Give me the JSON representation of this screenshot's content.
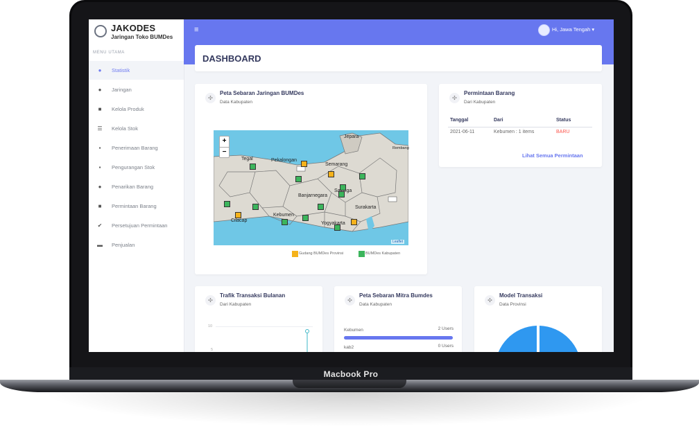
{
  "device": {
    "label": "Macbook Pro"
  },
  "brand": {
    "name": "JAKODES",
    "subtitle": "Jaringan Toko BUMDes"
  },
  "menu": {
    "heading": "MENU UTAMA",
    "items": [
      {
        "label": "Statistik",
        "icon": "dashboard-icon",
        "active": true
      },
      {
        "label": "Jaringan",
        "icon": "network-icon"
      },
      {
        "label": "Kelola Produk",
        "icon": "box-icon"
      },
      {
        "label": "Kelola Stok",
        "icon": "list-icon"
      },
      {
        "label": "Penerimaan Barang",
        "icon": "boxes-icon"
      },
      {
        "label": "Pengurangan Stok",
        "icon": "boxes-icon"
      },
      {
        "label": "Penarikan Barang",
        "icon": "truck-icon"
      },
      {
        "label": "Permintaan Barang",
        "icon": "clipboard-icon"
      },
      {
        "label": "Persetujuan Permintaan",
        "icon": "check-icon"
      },
      {
        "label": "Penjualan",
        "icon": "money-icon"
      }
    ]
  },
  "topbar": {
    "user_greeting": "Hi, Jawa Tengah"
  },
  "page": {
    "title": "DASHBOARD"
  },
  "map_card": {
    "title": "Peta Sebaran Jaringan BUMDes",
    "subtitle": "Data Kabupaten",
    "labels": [
      "Jepara",
      "Rembang",
      "Tegal",
      "Pekalongan",
      "Semarang",
      "Salatiga",
      "Banjarnegara",
      "Surakarta",
      "Kebumen",
      "Cilacap",
      "Yogyakarta"
    ],
    "legend": [
      {
        "label": "Gudang BUMDes Provinsi",
        "color": "#f5b21b"
      },
      {
        "label": "BUMDes Kabupaten",
        "color": "#3cb55c"
      }
    ],
    "attribution": "Leaflet"
  },
  "request_card": {
    "title": "Permintaan Barang",
    "subtitle": "Dari Kabupaten",
    "columns": [
      "Tanggal",
      "Dari",
      "Status"
    ],
    "rows": [
      {
        "date": "2021-06-11",
        "from": "Kebumen : 1 items",
        "status": "BARU"
      }
    ],
    "link": "Lihat Semua Permintaan"
  },
  "traffic_card": {
    "title": "Trafik Transaksi Bulanan",
    "subtitle": "Dari Kabupaten",
    "y_ticks": [
      "10",
      "5"
    ]
  },
  "partner_card": {
    "title": "Peta Sebaran Mitra Bumdes",
    "subtitle": "Data Kabupaten",
    "rows": [
      {
        "name": "Kebumen",
        "users": "2 Users",
        "fraction": 1.0
      },
      {
        "name": "kab2",
        "users": "0 Users",
        "fraction": 0.0
      }
    ]
  },
  "model_card": {
    "title": "Model Transaksi",
    "subtitle": "Data Provinsi"
  },
  "colors": {
    "accent": "#6777ef",
    "status_new": "#fc544b"
  }
}
